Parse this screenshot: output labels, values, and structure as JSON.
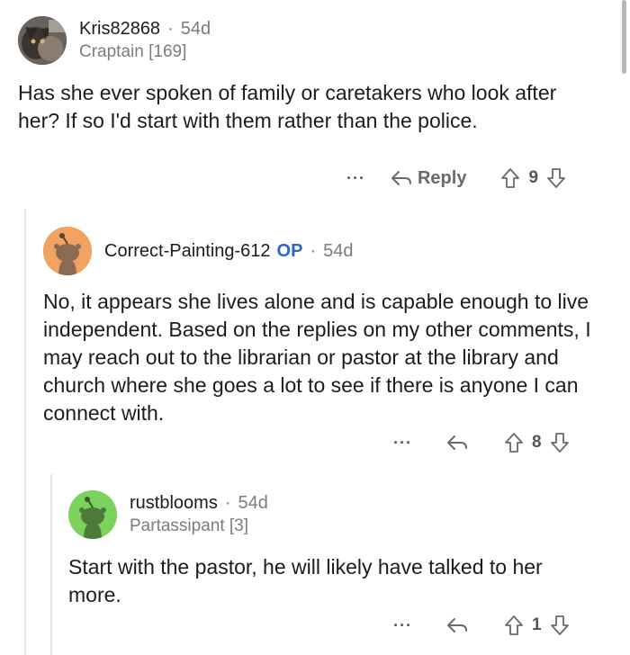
{
  "comments": [
    {
      "username": "Kris82868",
      "age": "54d",
      "flair": "Craptain [169]",
      "body": "Has she ever spoken of family or caretakers who look after her? If so I'd start with them rather than the police.",
      "more": "···",
      "reply_label": "Reply",
      "score": "9",
      "avatar_icon": "cat-photo-avatar"
    },
    {
      "username": "Correct-Painting-612",
      "op_tag": "OP",
      "age": "54d",
      "body": "No, it appears she lives alone and is capable enough to live independent. Based on the replies on my other comments, I may reach out to the librarian or pastor at the library and church where she goes a lot to see if there is anyone I can connect with.",
      "more": "···",
      "score": "8",
      "avatar_color": "#f2a261",
      "avatar_icon": "snoo-avatar"
    },
    {
      "username": "rustblooms",
      "age": "54d",
      "flair": "Partassipant [3]",
      "body": "Start with the pastor, he will likely have talked to her more.",
      "more": "···",
      "score": "1",
      "avatar_color": "#7bd35d",
      "avatar_icon": "snoo-avatar"
    }
  ],
  "separator": "·"
}
